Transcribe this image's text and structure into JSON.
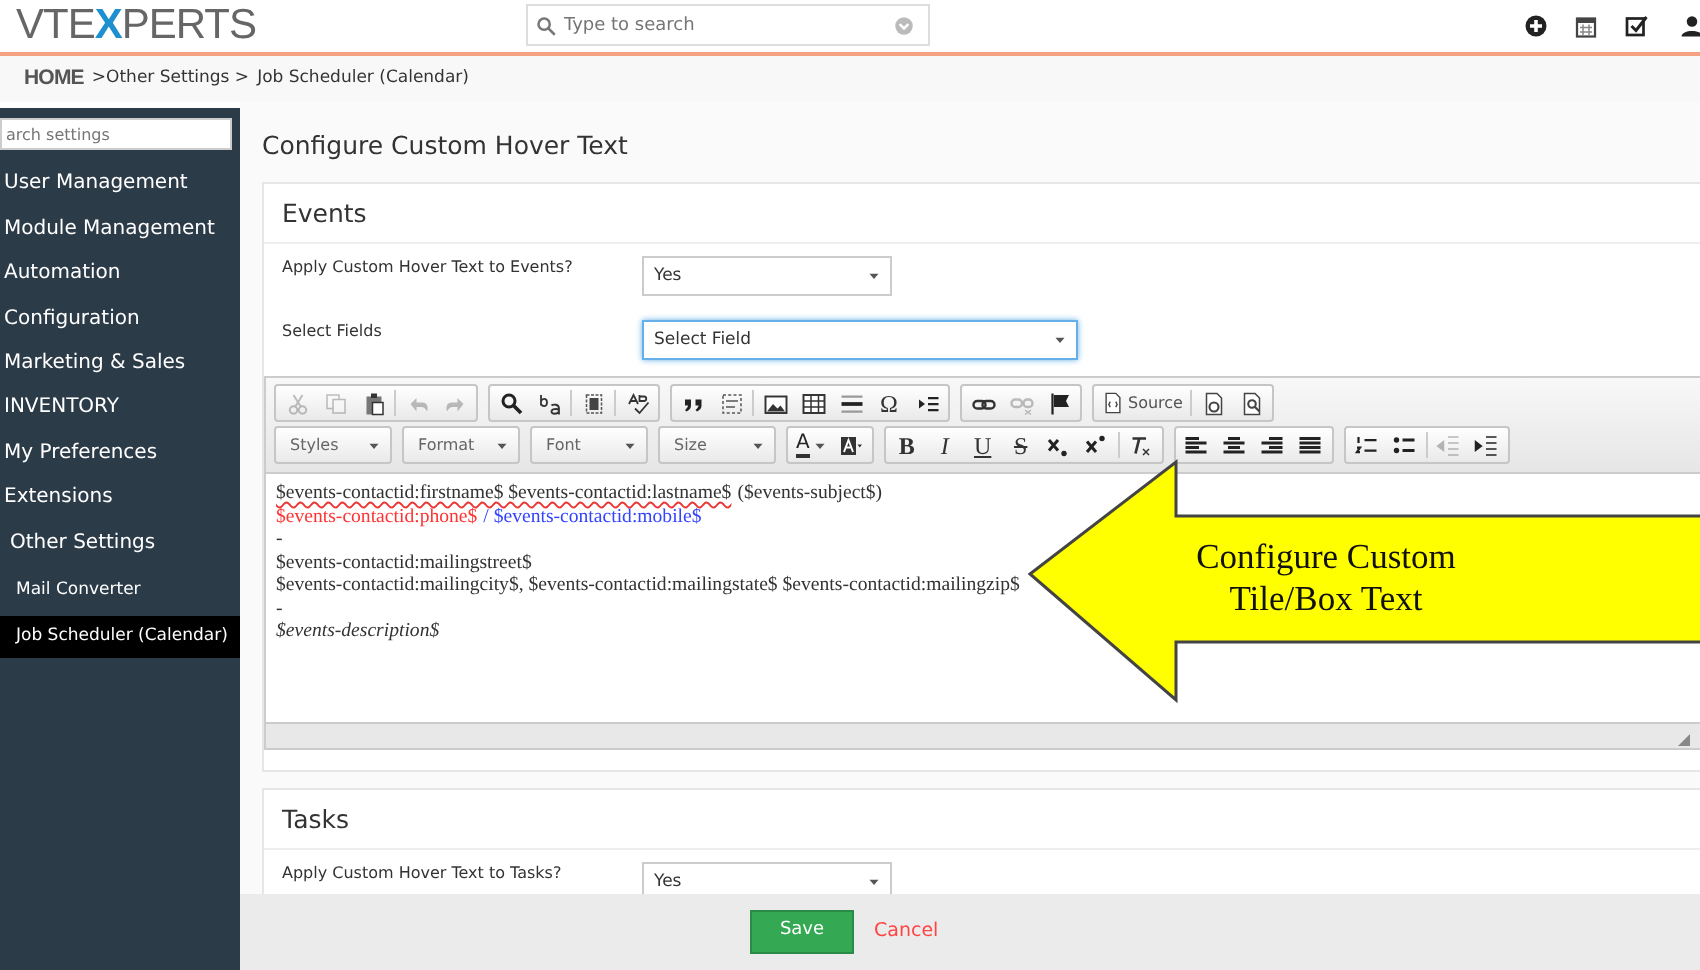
{
  "header": {
    "logo": {
      "before": "VTE",
      "mark": "X",
      "after": "PERTS"
    },
    "search": {
      "placeholder": "Type to search"
    }
  },
  "breadcrumb": [
    {
      "label": "HOME",
      "kind": "home"
    },
    {
      "label": ">Other Settings >",
      "kind": "link"
    },
    {
      "label": "Job Scheduler (Calendar)",
      "kind": "current"
    }
  ],
  "sidebar": {
    "search": {
      "placeholder": "arch settings"
    },
    "items": [
      {
        "label": "User Management",
        "selected": false
      },
      {
        "label": "Module Management",
        "selected": false
      },
      {
        "label": "Automation",
        "selected": false
      },
      {
        "label": "Configuration",
        "selected": false
      },
      {
        "label": "Marketing & Sales",
        "selected": false
      },
      {
        "label": "INVENTORY",
        "selected": false
      },
      {
        "label": "My Preferences",
        "selected": false
      },
      {
        "label": "Extensions",
        "selected": false
      },
      {
        "label": "Other Settings",
        "selected": false,
        "children": [
          {
            "label": "Mail Converter",
            "selected": false
          },
          {
            "label": "Job Scheduler (Calendar)",
            "selected": true
          }
        ]
      }
    ]
  },
  "page_title": "Configure Custom Hover Text",
  "events": {
    "title": "Events",
    "fields": [
      {
        "label": "Apply Custom Hover Text to Events?",
        "value": "Yes",
        "focused": false,
        "wide": false
      },
      {
        "label": "Select Fields",
        "value": "Select Field",
        "focused": true,
        "wide": true
      }
    ],
    "editor": {
      "toolbar": [
        [
          [
            {
              "kind": "cut",
              "disabled": true
            },
            {
              "kind": "copy",
              "disabled": true
            },
            {
              "kind": "paste",
              "disabled": false
            },
            {
              "kind": "sep"
            },
            {
              "kind": "undo",
              "disabled": true
            },
            {
              "kind": "redo",
              "disabled": true
            }
          ],
          [
            {
              "kind": "find",
              "disabled": false
            },
            {
              "kind": "replace",
              "disabled": false
            },
            {
              "kind": "sep"
            },
            {
              "kind": "selectall",
              "disabled": false
            },
            {
              "kind": "sep"
            },
            {
              "kind": "spellcheck",
              "disabled": false
            }
          ],
          [
            {
              "kind": "quote",
              "disabled": false
            },
            {
              "kind": "div",
              "disabled": false
            },
            {
              "kind": "sep"
            },
            {
              "kind": "image",
              "disabled": false
            },
            {
              "kind": "table",
              "disabled": false
            },
            {
              "kind": "hline",
              "disabled": false
            },
            {
              "kind": "glyph",
              "label": "Ω",
              "disabled": false
            },
            {
              "kind": "pagebreak",
              "disabled": false
            }
          ],
          [
            {
              "kind": "link",
              "disabled": false
            },
            {
              "kind": "unlink",
              "disabled": true
            },
            {
              "kind": "anchor",
              "disabled": false
            }
          ],
          [
            {
              "kind": "source",
              "label": "Source",
              "disabled": false
            },
            {
              "kind": "sep"
            },
            {
              "kind": "template",
              "disabled": false
            },
            {
              "kind": "preview",
              "disabled": false
            }
          ]
        ],
        [
          [
            {
              "kind": "combo",
              "label": "Styles"
            }
          ],
          [
            {
              "kind": "combo",
              "label": "Format"
            }
          ],
          [
            {
              "kind": "combo",
              "label": "Font"
            }
          ],
          [
            {
              "kind": "combo",
              "label": "Size"
            }
          ],
          [
            {
              "kind": "textcolor",
              "label": "A",
              "disabled": false
            },
            {
              "kind": "bgcolor",
              "disabled": false
            }
          ],
          [
            {
              "kind": "bold",
              "label": "B",
              "disabled": false
            },
            {
              "kind": "italic",
              "label": "I",
              "disabled": false
            },
            {
              "kind": "underline",
              "label": "U",
              "disabled": false
            },
            {
              "kind": "strike",
              "label": "S",
              "disabled": false
            },
            {
              "kind": "subscript",
              "disabled": false
            },
            {
              "kind": "superscript",
              "disabled": false
            },
            {
              "kind": "sep"
            },
            {
              "kind": "removeformat",
              "disabled": false
            }
          ],
          [
            {
              "kind": "alignleft",
              "disabled": false
            },
            {
              "kind": "aligncenter",
              "disabled": false
            },
            {
              "kind": "alignright",
              "disabled": false
            },
            {
              "kind": "justify",
              "disabled": false
            }
          ],
          [
            {
              "kind": "numbered",
              "disabled": false
            },
            {
              "kind": "bulleted",
              "disabled": false
            },
            {
              "kind": "sep"
            },
            {
              "kind": "outdent",
              "disabled": true
            },
            {
              "kind": "indent",
              "disabled": false
            }
          ]
        ]
      ],
      "lines": [
        {
          "segments": [
            {
              "text": "$events-contactid:firstname$ $events-contactid:lastname$",
              "color": "#333333",
              "misspelled": true,
              "italic": false
            },
            {
              "text": "($events-subject$)",
              "color": "#333333",
              "misspelled": false,
              "italic": false
            }
          ]
        },
        {
          "segments": [
            {
              "text": "$events-contactid:phone$",
              "color": "#ff3333",
              "misspelled": false,
              "italic": false
            },
            {
              "text": "/ $events-contactid:mobile$",
              "color": "#3344ff",
              "misspelled": false,
              "italic": false
            }
          ]
        },
        {
          "segments": [
            {
              "text": "-",
              "color": "#333333",
              "misspelled": false
            }
          ]
        },
        {
          "segments": [
            {
              "text": "$events-contactid:mailingstreet$",
              "color": "#333333",
              "misspelled": false,
              "italic": false
            }
          ]
        },
        {
          "segments": [
            {
              "text": "$events-contactid:mailingcity$, $events-contactid:mailingstate$ $events-contactid:mailingzip$",
              "color": "#333333",
              "misspelled": false,
              "italic": false
            }
          ]
        },
        {
          "segments": [
            {
              "text": "-",
              "color": "#333333",
              "misspelled": false
            }
          ]
        },
        {
          "segments": [
            {
              "text": "$events-description$",
              "color": "#333333",
              "misspelled": false,
              "italic": true
            }
          ]
        }
      ]
    }
  },
  "callout": {
    "lines": [
      "Configure Custom",
      "Tile/Box Text"
    ]
  },
  "tasks": {
    "title": "Tasks",
    "fields": [
      {
        "label": "Apply Custom Hover Text to Tasks?",
        "value": "Yes",
        "focused": false,
        "wide": false
      }
    ]
  },
  "buttons": [
    {
      "label": "Save",
      "kind": "primary"
    },
    {
      "label": "Cancel",
      "kind": "link"
    }
  ]
}
